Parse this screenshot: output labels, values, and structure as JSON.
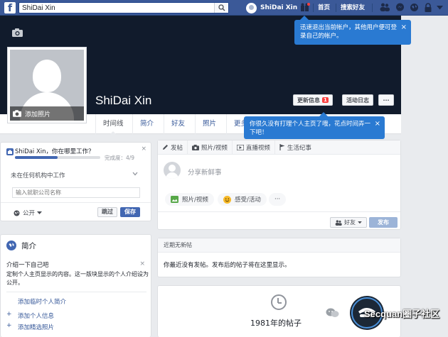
{
  "topbar": {
    "logo": "f",
    "search_value": "ShiDai Xin",
    "user_name": "ShiDai Xin",
    "home_label": "首页",
    "find_friends_label": "搜索好友",
    "icons": [
      "search-icon",
      "friends-icon",
      "messages-icon",
      "globe-icon",
      "lock-icon",
      "chevron-down-icon"
    ],
    "bar_color": "#3b5998"
  },
  "cover": {
    "add_photo_label": "添加照片",
    "name": "ShiDai Xin",
    "update_info_label": "更新信息",
    "update_info_badge": "1",
    "activity_log_label": "活动日志",
    "more_label": "···"
  },
  "tabs": [
    {
      "label": "时间线",
      "active": true
    },
    {
      "label": "简介",
      "active": false
    },
    {
      "label": "好友",
      "active": false
    },
    {
      "label": "照片",
      "active": false
    },
    {
      "label": "更多",
      "active": false
    }
  ],
  "tooltips": {
    "switch_account": "迅速退出当前帐户，其他用户便可登录自己的帐户。",
    "update_profile": "你很久没有打理个人主页了哦，花点时间弄一下吧！",
    "close": "×"
  },
  "work_card": {
    "title": "ShiDai Xin，你在哪里工作？",
    "progress": 0.5,
    "progress_label": "完成度：4/9",
    "question": "未在任何机构中工作",
    "input_placeholder": "输入就职公司名称",
    "privacy_label": "公开",
    "skip_label": "跳过",
    "save_label": "保存",
    "close": "×"
  },
  "intro": {
    "title": "简介",
    "subtitle": "介绍一下自己吧",
    "description": "定制个人主页显示的内容。这一版块显示的个人介绍设为公开。",
    "close": "×",
    "links": [
      "添加临时个人简介",
      "添加个人信息",
      "添加精选照片"
    ]
  },
  "composer": {
    "tabs": [
      "发帖",
      "照片/视频",
      "直播视频",
      "生活纪事"
    ],
    "placeholder": "分享新鲜事",
    "options": [
      "照片/视频",
      "感受/活动",
      "···"
    ],
    "audience_label": "好友",
    "post_label": "发布"
  },
  "recent": {
    "title": "近期无新帖",
    "body": "你最近没有发帖。发布后的帖子将在这里显示。"
  },
  "year_section": {
    "label": "1981年的帖子"
  },
  "watermark": {
    "text": "Secquan圈子社区"
  }
}
